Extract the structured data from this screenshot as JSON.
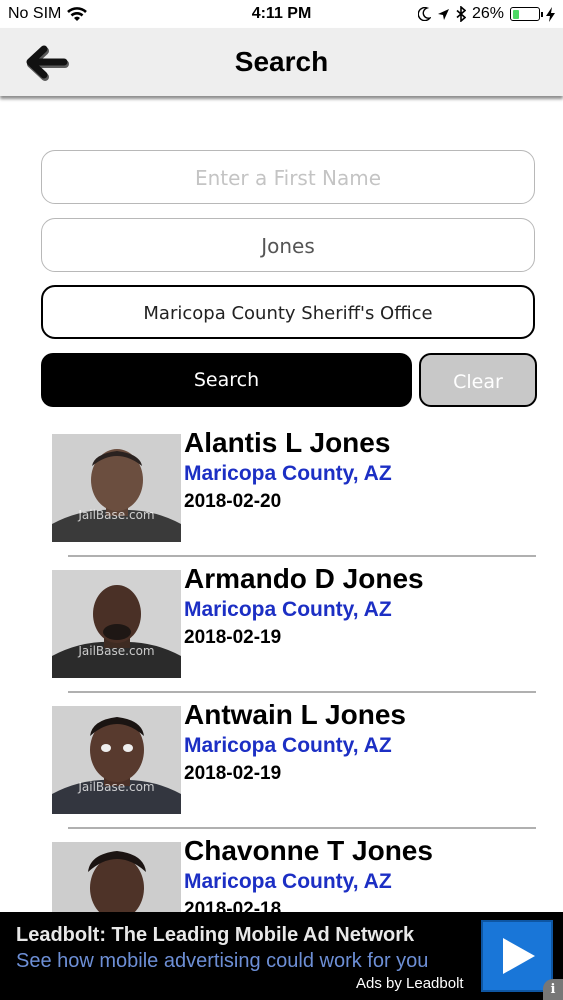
{
  "status_bar": {
    "carrier": "No SIM",
    "time": "4:11 PM",
    "battery": "26%",
    "battery_level": 0.26
  },
  "nav": {
    "title": "Search",
    "back_icon": "back-arrow-icon"
  },
  "form": {
    "first_name": {
      "value": "",
      "placeholder": "Enter a First Name"
    },
    "last_name": {
      "value": "Jones"
    },
    "agency": {
      "value": "Maricopa County Sheriff's Office"
    },
    "search_label": "Search",
    "clear_label": "Clear"
  },
  "results": [
    {
      "name": "Alantis L Jones",
      "location": "Maricopa County, AZ",
      "date": "2018-02-20",
      "watermark": "JailBase.com"
    },
    {
      "name": "Armando D Jones",
      "location": "Maricopa County, AZ",
      "date": "2018-02-19",
      "watermark": "JailBase.com"
    },
    {
      "name": "Antwain L Jones",
      "location": "Maricopa County, AZ",
      "date": "2018-02-19",
      "watermark": "JailBase.com"
    },
    {
      "name": "Chavonne T Jones",
      "location": "Maricopa County, AZ",
      "date": "2018-02-18",
      "watermark": ""
    }
  ],
  "ad": {
    "title": "Leadbolt: The Leading Mobile Ad Network",
    "subtitle": "See how mobile advertising could work for you",
    "credit": "Ads by Leadbolt",
    "play_icon": "play-icon",
    "info_label": "i"
  },
  "colors": {
    "link_blue": "#1c2fc4",
    "nav_background": "#eeeeee",
    "ad_play_blue": "#1976d8"
  }
}
